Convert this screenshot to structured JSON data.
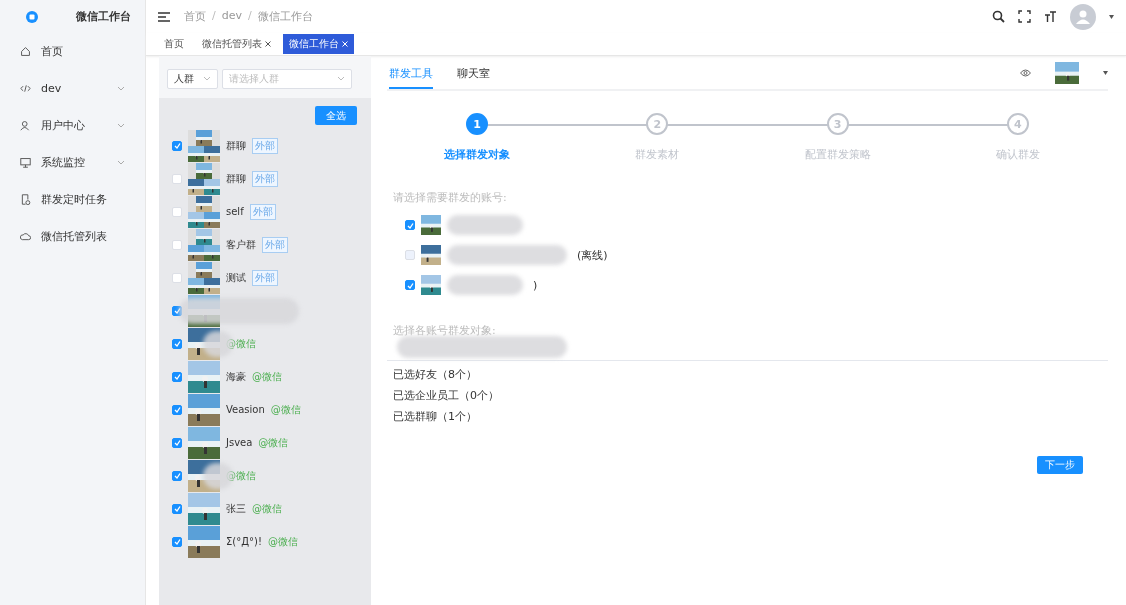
{
  "sidebar": {
    "title": "微信工作台",
    "items": [
      {
        "label": "首页",
        "expandable": false
      },
      {
        "label": "dev",
        "expandable": true
      },
      {
        "label": "用户中心",
        "expandable": true
      },
      {
        "label": "系统监控",
        "expandable": true
      },
      {
        "label": "群发定时任务",
        "expandable": false
      },
      {
        "label": "微信托管列表",
        "expandable": false
      }
    ]
  },
  "breadcrumb": {
    "separator": "/",
    "items": [
      "首页",
      "dev",
      "微信工作台"
    ]
  },
  "tabs": [
    {
      "label": "首页",
      "closable": false,
      "selected": false
    },
    {
      "label": "微信托管列表",
      "closable": true,
      "selected": false
    },
    {
      "label": "微信工作台",
      "closable": true,
      "selected": true
    }
  ],
  "filter": {
    "type": "人群",
    "placeholder": "请选择人群"
  },
  "select_all": "全选",
  "contacts": [
    {
      "name": "群聊",
      "tag": "外部",
      "kind": "group",
      "checked": true
    },
    {
      "name": "群聊",
      "tag": "外部",
      "kind": "group",
      "checked": false
    },
    {
      "name": "self",
      "tag": "外部",
      "kind": "group",
      "checked": false
    },
    {
      "name": "客户群",
      "tag": "外部",
      "kind": "group",
      "checked": false
    },
    {
      "name": "测试",
      "tag": "外部",
      "kind": "group",
      "checked": false
    },
    {
      "kind": "person",
      "checked": true
    },
    {
      "tag": "@微信",
      "kind": "person",
      "checked": true
    },
    {
      "name": "海豪",
      "tag": "@微信",
      "kind": "person",
      "checked": true
    },
    {
      "name": "Veasion",
      "tag": "@微信",
      "kind": "person",
      "checked": true
    },
    {
      "name": "Jsvea",
      "tag": "@微信",
      "kind": "person",
      "checked": true
    },
    {
      "tag": "@微信",
      "kind": "person",
      "checked": true
    },
    {
      "name": "张三",
      "tag": "@微信",
      "kind": "person",
      "checked": true
    },
    {
      "name": "Σ(°Д°)!",
      "tag": "@微信",
      "kind": "person",
      "checked": true
    }
  ],
  "main_tabs": [
    {
      "label": "群发工具",
      "selected": true
    },
    {
      "label": "聊天室",
      "selected": false
    }
  ],
  "steps": [
    {
      "number": "1",
      "label": "选择群发对象",
      "selected": true
    },
    {
      "number": "2",
      "label": "群发素材",
      "selected": false
    },
    {
      "number": "3",
      "label": "配置群发策略",
      "selected": false
    },
    {
      "number": "4",
      "label": "确认群发",
      "selected": false
    }
  ],
  "accounts_label": "请选择需要群发的账号:",
  "accounts": [
    {
      "checked": true,
      "disabled": false
    },
    {
      "checked": false,
      "disabled": true,
      "note": "(离线)"
    },
    {
      "checked": true,
      "disabled": false,
      "note": ")"
    }
  ],
  "targets_label": "选择各账号群发对象:",
  "summary": [
    "已选好友（8个）",
    "已选企业员工（0个）",
    "已选群聊（1个）"
  ],
  "next_button": "下一步"
}
